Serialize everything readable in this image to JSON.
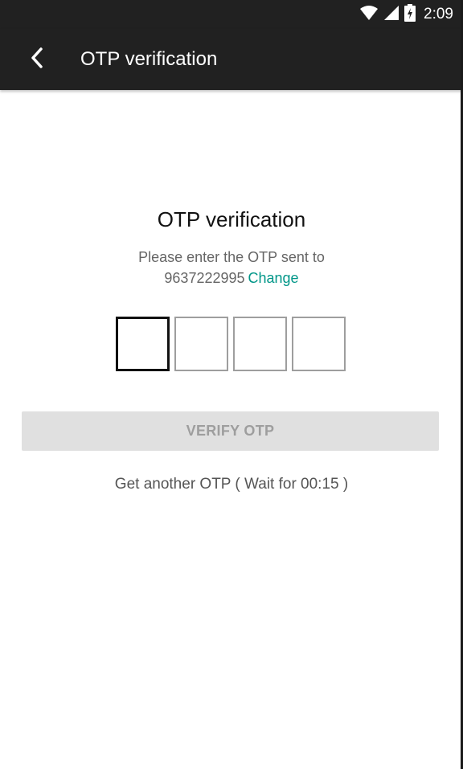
{
  "status_bar": {
    "time": "2:09",
    "icons": [
      "wifi-icon",
      "signal-icon",
      "battery-charging-icon"
    ]
  },
  "app_bar": {
    "title": "OTP verification",
    "back_icon": "back-arrow-icon"
  },
  "main": {
    "heading": "OTP verification",
    "subtitle": "Please enter the OTP sent to",
    "phone": "9637222995",
    "change_label": "Change",
    "otp_digits": [
      "",
      "",
      "",
      ""
    ],
    "verify_label": "VERIFY OTP",
    "resend_text": "Get another OTP ( Wait for 00:15 )"
  },
  "colors": {
    "app_bar": "#212121",
    "accent": "#009688",
    "button_disabled_bg": "#e0e0e0",
    "button_disabled_text": "#9e9e9e"
  }
}
